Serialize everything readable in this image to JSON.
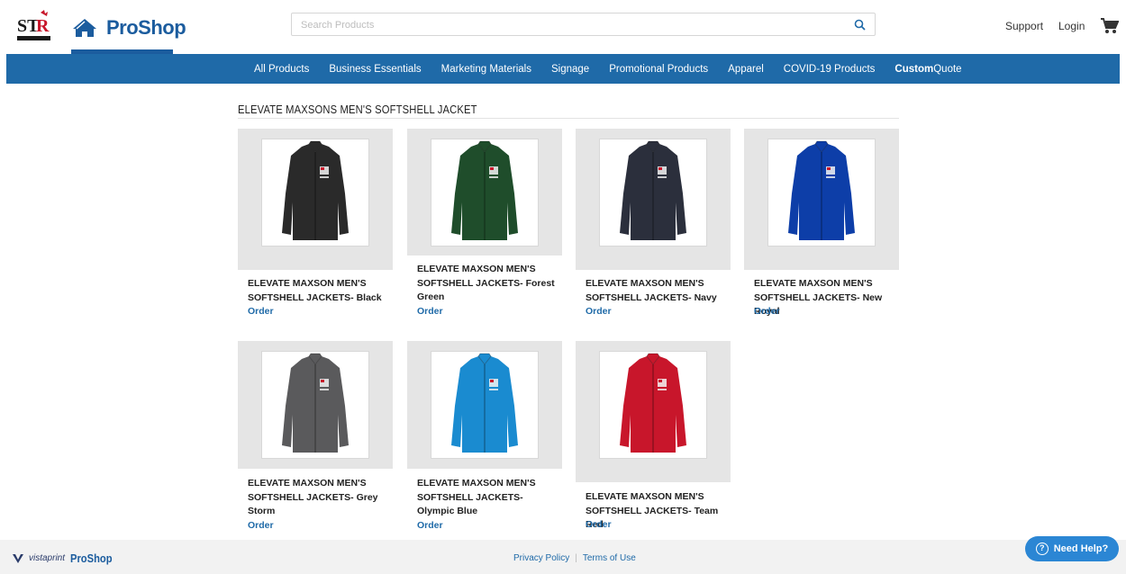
{
  "header": {
    "brand_logo_text": "STR",
    "proshop_label": "ProShop",
    "search": {
      "placeholder": "Search Products",
      "value": ""
    },
    "support_label": "Support",
    "login_label": "Login"
  },
  "nav": {
    "items": [
      {
        "label": "All Products"
      },
      {
        "label": "Business Essentials"
      },
      {
        "label": "Marketing Materials"
      },
      {
        "label": "Signage"
      },
      {
        "label": "Promotional Products"
      },
      {
        "label": "Apparel"
      },
      {
        "label": "COVID-19 Products"
      }
    ],
    "custom_quote": {
      "bold": "Custom",
      "rest": "Quote"
    }
  },
  "page": {
    "title": "ELEVATE MAXSONS MEN'S SOFTSHELL JACKET"
  },
  "products": [
    {
      "name": "ELEVATE MAXSON MEN'S SOFTSHELL JACKETS- Black",
      "order": "Order",
      "color": "#2a2a2a"
    },
    {
      "name": "ELEVATE MAXSON MEN'S SOFTSHELL JACKETS- Forest Green",
      "order": "Order",
      "color": "#1f4d2b"
    },
    {
      "name": "ELEVATE MAXSON MEN'S SOFTSHELL JACKETS- Navy",
      "order": "Order",
      "color": "#2b2f3c"
    },
    {
      "name": "ELEVATE MAXSON MEN'S SOFTSHELL JACKETS- New Royal",
      "order": "Order",
      "color": "#0d3ea8"
    },
    {
      "name": "ELEVATE MAXSON MEN'S SOFTSHELL JACKETS- Grey Storm",
      "order": "Order",
      "color": "#5a5a5c"
    },
    {
      "name": "ELEVATE MAXSON MEN'S SOFTSHELL JACKETS- Olympic Blue",
      "order": "Order",
      "color": "#1a8bd0"
    },
    {
      "name": "ELEVATE MAXSON MEN'S SOFTSHELL JACKETS- Team Red",
      "order": "Order",
      "color": "#c8162b"
    }
  ],
  "footer": {
    "vistaprint_label": "vistaprint",
    "proshop_label": "ProShop",
    "privacy_label": "Privacy Policy",
    "separator": "|",
    "terms_label": "Terms of Use"
  },
  "help": {
    "label": "Need Help?"
  },
  "colors": {
    "brand_blue": "#1f6aa8",
    "accent": "#1b5c9e"
  }
}
